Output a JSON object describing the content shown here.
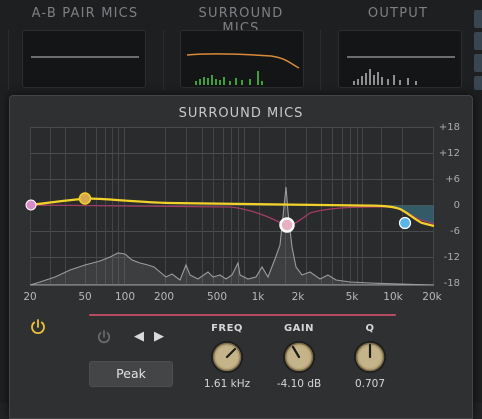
{
  "top": {
    "sections": [
      {
        "title": "A-B PAIR MICS"
      },
      {
        "title": "SURROUND MICS"
      },
      {
        "title": "OUTPUT"
      }
    ]
  },
  "eq": {
    "title": "SURROUND MICS",
    "db_labels": [
      "+18",
      "+12",
      "+6",
      "0",
      "-6",
      "-12",
      "-18"
    ],
    "freq_labels": [
      "20",
      "50",
      "100",
      "200",
      "500",
      "1k",
      "2k",
      "5k",
      "10k",
      "20k"
    ],
    "band": {
      "type_label": "Peak",
      "freq_label": "FREQ",
      "gain_label": "GAIN",
      "q_label": "Q",
      "freq_value": "1.61 kHz",
      "gain_value": "-4.10 dB",
      "q_value": "0.707"
    },
    "colors": {
      "curve": "#f2d22a",
      "band_curve": "#a23c64",
      "accent": "#b64b64",
      "power_active": "#f0c23a"
    },
    "icons": {
      "power_main": "power-icon",
      "power_band": "power-icon",
      "prev": "triangle-left-icon",
      "next": "triangle-right-icon"
    }
  }
}
